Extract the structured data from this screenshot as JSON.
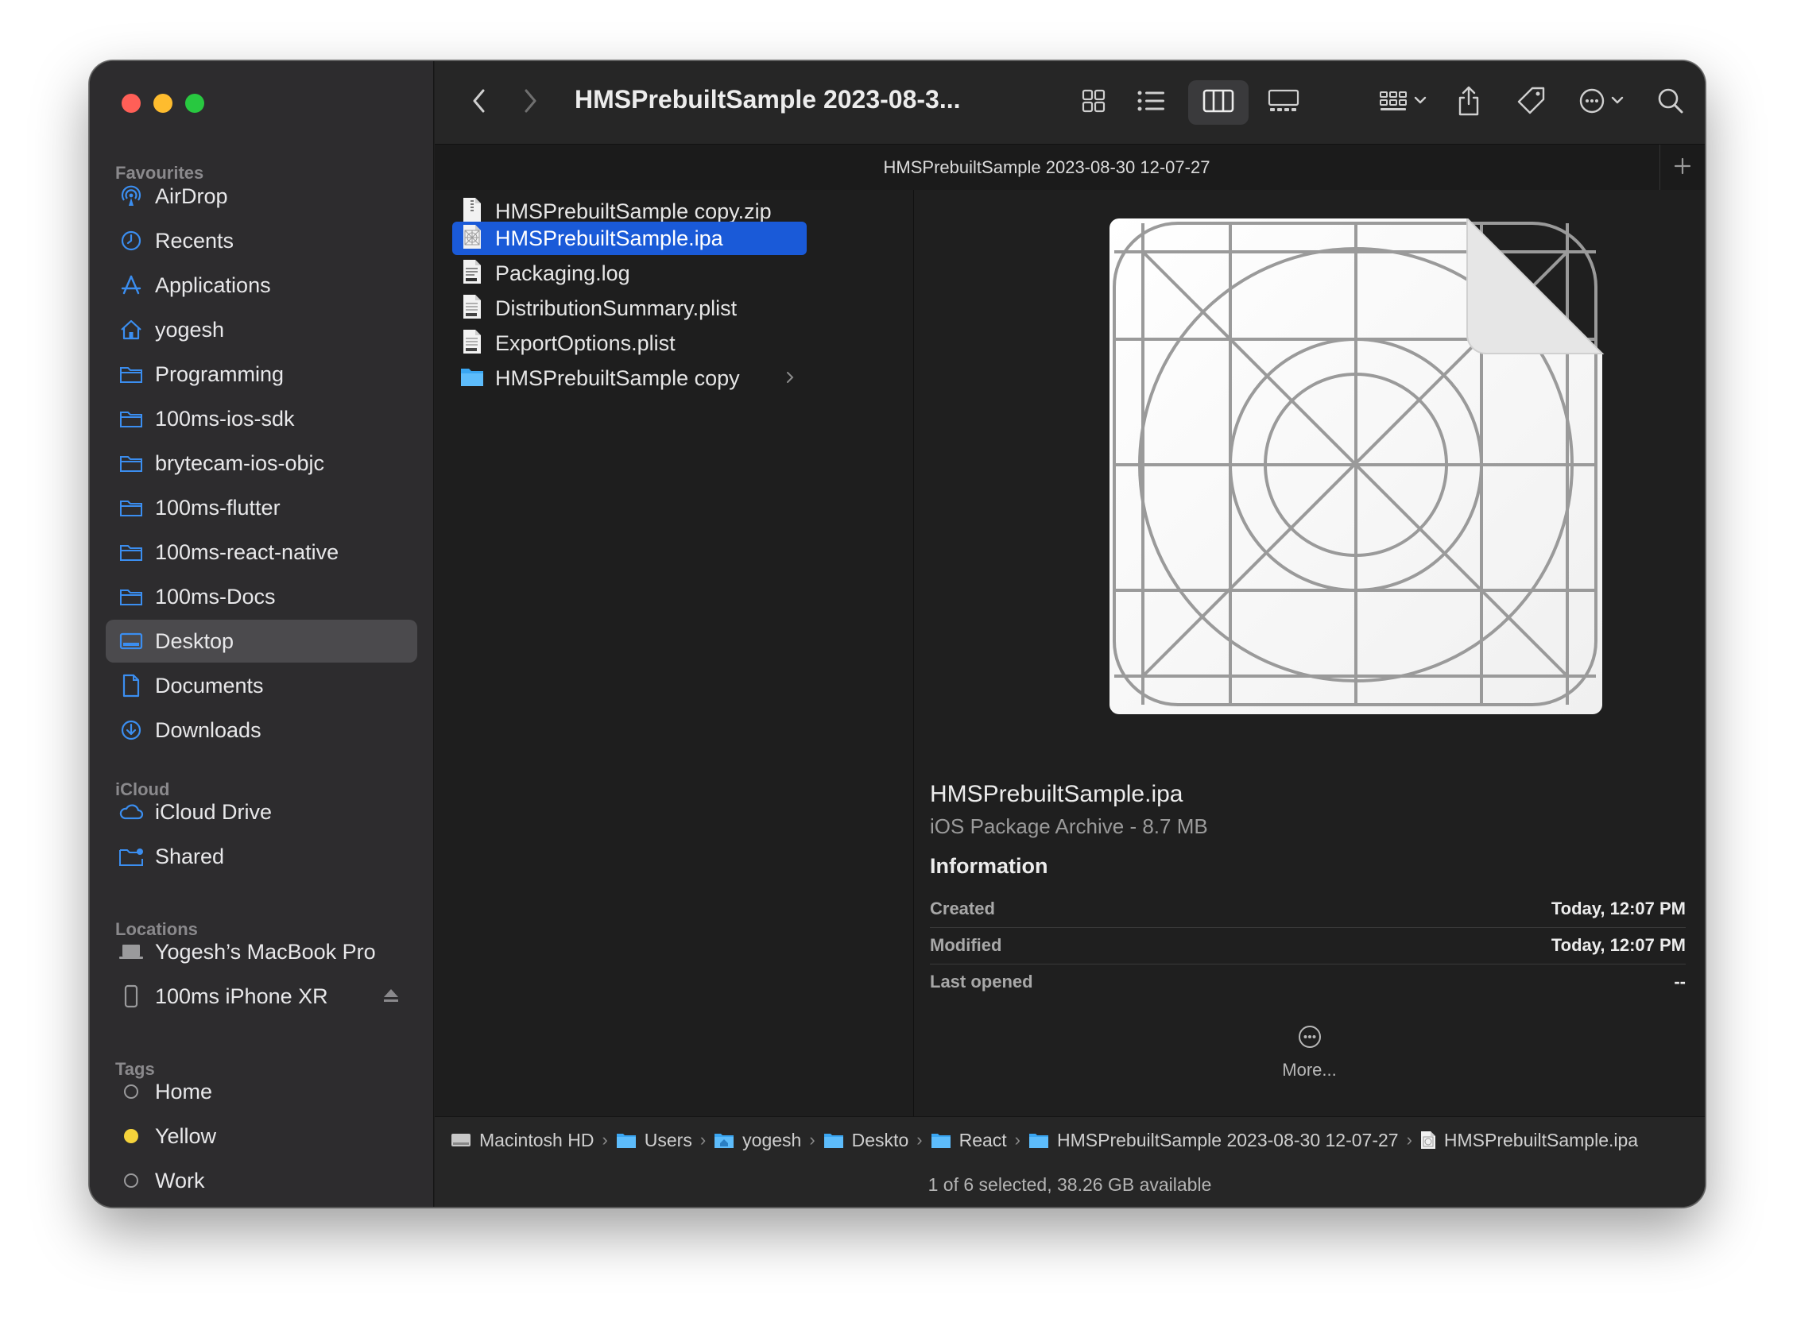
{
  "window": {
    "title": "HMSPrebuiltSample 2023-08-3...",
    "tab_title": "HMSPrebuiltSample 2023-08-30 12-07-27"
  },
  "sidebar": {
    "favourites_header": "Favourites",
    "favourites": [
      {
        "label": "AirDrop",
        "icon": "airdrop-icon"
      },
      {
        "label": "Recents",
        "icon": "clock-icon"
      },
      {
        "label": "Applications",
        "icon": "applications-icon"
      },
      {
        "label": "yogesh",
        "icon": "home-icon"
      },
      {
        "label": "Programming",
        "icon": "folder-icon"
      },
      {
        "label": "100ms-ios-sdk",
        "icon": "folder-icon"
      },
      {
        "label": "brytecam-ios-objc",
        "icon": "folder-icon"
      },
      {
        "label": "100ms-flutter",
        "icon": "folder-icon"
      },
      {
        "label": "100ms-react-native",
        "icon": "folder-icon"
      },
      {
        "label": "100ms-Docs",
        "icon": "folder-icon"
      },
      {
        "label": "Desktop",
        "icon": "desktop-icon",
        "active": true
      },
      {
        "label": "Documents",
        "icon": "document-icon"
      },
      {
        "label": "Downloads",
        "icon": "download-icon"
      }
    ],
    "icloud_header": "iCloud",
    "icloud": [
      {
        "label": "iCloud Drive",
        "icon": "cloud-icon"
      },
      {
        "label": "Shared",
        "icon": "shared-folder-icon"
      }
    ],
    "locations_header": "Locations",
    "locations": [
      {
        "label": "Yogesh’s MacBook Pro",
        "icon": "laptop-icon"
      },
      {
        "label": "100ms iPhone XR",
        "icon": "phone-icon"
      }
    ],
    "tags_header": "Tags",
    "tags": [
      {
        "label": "Home",
        "color": "none"
      },
      {
        "label": "Yellow",
        "color": "#f5d33b"
      },
      {
        "label": "Work",
        "color": "none"
      }
    ]
  },
  "files": [
    {
      "name": "HMSPrebuiltSample copy.zip",
      "kind": "zip"
    },
    {
      "name": "HMSPrebuiltSample.ipa",
      "kind": "ipa",
      "selected": true
    },
    {
      "name": "Packaging.log",
      "kind": "log"
    },
    {
      "name": "DistributionSummary.plist",
      "kind": "plist"
    },
    {
      "name": "ExportOptions.plist",
      "kind": "plist"
    },
    {
      "name": "HMSPrebuiltSample copy",
      "kind": "folder"
    }
  ],
  "preview": {
    "name": "HMSPrebuiltSample.ipa",
    "kind": "iOS Package Archive - 8.7 MB",
    "info_header": "Information",
    "info": [
      {
        "key": "Created",
        "value": "Today, 12:07 PM"
      },
      {
        "key": "Modified",
        "value": "Today, 12:07 PM"
      },
      {
        "key": "Last opened",
        "value": "--"
      }
    ],
    "more_label": "More..."
  },
  "pathbar": [
    {
      "label": "Macintosh HD",
      "icon": "disk-icon"
    },
    {
      "label": "Users",
      "icon": "folder-icon"
    },
    {
      "label": "yogesh",
      "icon": "home-folder-icon"
    },
    {
      "label": "Deskto",
      "icon": "folder-icon"
    },
    {
      "label": "React",
      "icon": "folder-icon"
    },
    {
      "label": "HMSPrebuiltSample 2023-08-30 12-07-27",
      "icon": "folder-icon"
    },
    {
      "label": "HMSPrebuiltSample.ipa",
      "icon": "file-icon"
    }
  ],
  "status": "1 of 6 selected, 38.26 GB available",
  "colors": {
    "accent": "#1a5ad8",
    "sidebar_icon": "#3b8ef0",
    "close": "#ff5f57",
    "minimize": "#febc2e",
    "zoom": "#28c840",
    "tag_yellow": "#f5d33b"
  }
}
